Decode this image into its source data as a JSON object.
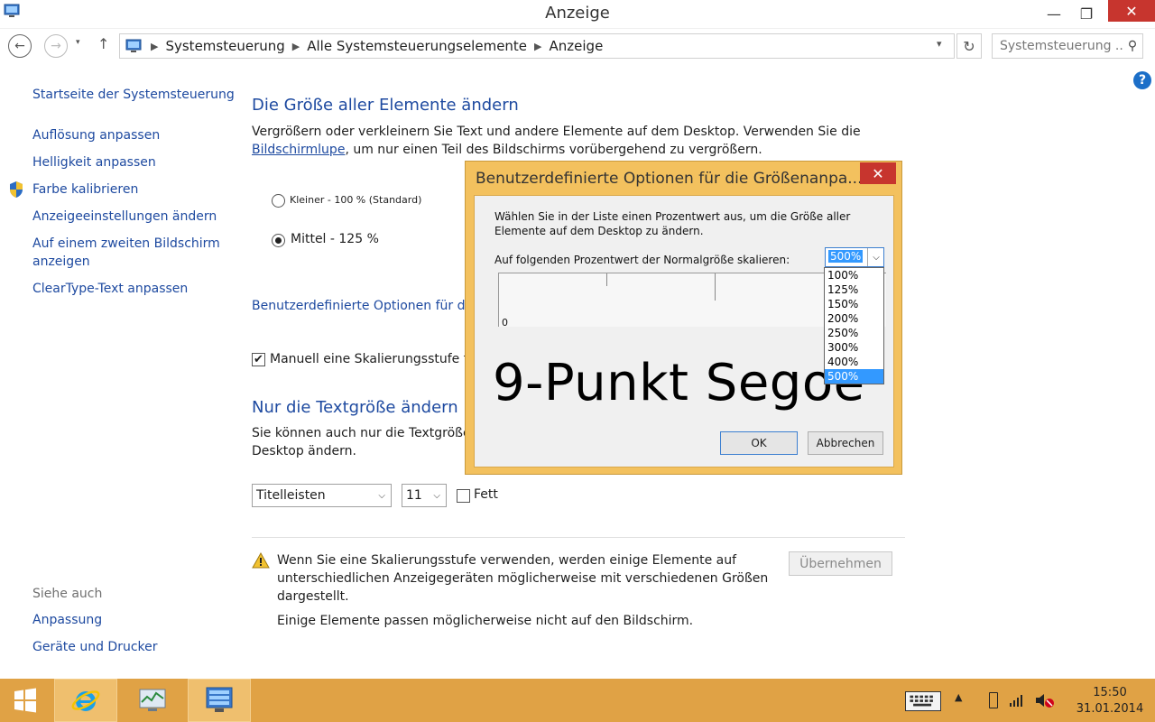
{
  "window": {
    "title": "Anzeige",
    "minimize": "—",
    "maximize": "❐",
    "close": "✕"
  },
  "nav": {
    "back": "←",
    "forward": "→",
    "recent": "▾",
    "up": "↑",
    "breadcrumbs": [
      "Systemsteuerung",
      "Alle Systemsteuerungselemente",
      "Anzeige"
    ],
    "dropdown": "▾",
    "refresh": "↻",
    "search_placeholder": "Systemsteuerung ...",
    "search_glyph": "⚲"
  },
  "help": "?",
  "left_panel": {
    "home": "Startseite der Systemsteuerung",
    "links": [
      "Auflösung anpassen",
      "Helligkeit anpassen",
      "Farbe kalibrieren",
      "Anzeigeeinstellungen ändern",
      "Auf einem zweiten Bildschirm",
      "anzeigen",
      "ClearType-Text anpassen"
    ],
    "see_also": "Siehe auch",
    "see_also_links": [
      "Anpassung",
      "Geräte und Drucker"
    ]
  },
  "main": {
    "heading1": "Die Größe aller Elemente ändern",
    "intro_line1": "Vergrößern oder verkleinern Sie Text und andere Elemente auf dem Desktop. Verwenden Sie die",
    "intro_link": "Bildschirmlupe",
    "intro_line2_rest": ", um nur einen Teil des Bildschirms vorübergehend zu vergrößern.",
    "radio_small": "Kleiner - 100 % (Standard)",
    "radio_medium": "Mittel - 125 %",
    "custom_link": "Benutzerdefinierte Optionen für die",
    "manual_checkbox": "Manuell eine Skalierungsstufe für",
    "check_glyph": "✔",
    "heading2": "Nur die Textgröße ändern",
    "text_line1": "Sie können auch nur die Textgröße e",
    "text_line2": "Desktop ändern.",
    "element_select": "Titelleisten",
    "size_select": "11",
    "bold_label": "Fett",
    "select_chevron": "⌵",
    "warning_line1": "Wenn Sie eine Skalierungsstufe verwenden, werden einige Elemente auf",
    "warning_line2": "unterschiedlichen Anzeigegeräten möglicherweise mit verschiedenen Größen",
    "warning_line3": "dargestellt.",
    "note": "Einige Elemente passen möglicherweise nicht auf den Bildschirm.",
    "apply_button": "Übernehmen"
  },
  "dialog": {
    "title": "Benutzerdefinierte Optionen für die Größenanpa...",
    "close": "✕",
    "desc_line1": "Wählen Sie in der Liste einen Prozentwert aus, um die Größe aller",
    "desc_line2": "Elemente auf dem Desktop zu ändern.",
    "scale_label": "Auf folgenden Prozentwert der Normalgröße skalieren:",
    "combo_value": "500%",
    "combo_chevron": "⌵",
    "ruler_zero": "0",
    "sample_text": "9-Punkt Segoe",
    "ok": "OK",
    "cancel": "Abbrechen",
    "options": [
      "100%",
      "125%",
      "150%",
      "200%",
      "250%",
      "300%",
      "400%",
      "500%"
    ],
    "selected_option": "500%"
  },
  "taskbar": {
    "tray_up": "▲",
    "time": "15:50",
    "date": "31.01.2014"
  },
  "colors": {
    "accent_link": "#1e4aa0",
    "taskbar": "#e0a245",
    "dialog_frame": "#f3c15e",
    "close_red": "#c7352e",
    "selection": "#3399ff"
  }
}
